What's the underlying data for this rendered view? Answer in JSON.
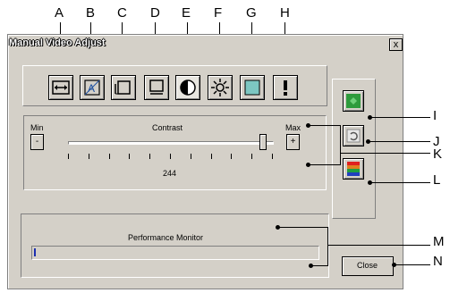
{
  "window": {
    "title": "Manual Video Adjust",
    "close_glyph": "x"
  },
  "toolbar": {
    "buttons": [
      {
        "id": "A",
        "icon": "width-adjust-icon"
      },
      {
        "id": "B",
        "icon": "focus-icon"
      },
      {
        "id": "C",
        "icon": "horizontal-position-icon"
      },
      {
        "id": "D",
        "icon": "vertical-position-icon"
      },
      {
        "id": "E",
        "icon": "contrast-icon"
      },
      {
        "id": "F",
        "icon": "brightness-icon"
      },
      {
        "id": "G",
        "icon": "noise-threshold-icon"
      },
      {
        "id": "H",
        "icon": "priority-threshold-icon"
      }
    ]
  },
  "adjust": {
    "min_label": "Min",
    "max_label": "Max",
    "name": "Contrast",
    "minus": "-",
    "plus": "+",
    "value": "244",
    "slider_fraction": 0.957
  },
  "side": {
    "buttons": [
      {
        "id": "I",
        "icon": "auto-adjust-icon"
      },
      {
        "id": "J",
        "icon": "refresh-icon"
      },
      {
        "id": "L",
        "icon": "color-bars-icon"
      }
    ]
  },
  "performance": {
    "label": "Performance Monitor"
  },
  "close_button": {
    "label": "Close"
  },
  "callouts": [
    "A",
    "B",
    "C",
    "D",
    "E",
    "F",
    "G",
    "H",
    "I",
    "J",
    "K",
    "L",
    "M",
    "N"
  ],
  "colors": {
    "dialog_bg": "#d4d0c8",
    "green_button": "#2e9b3c",
    "teal_icon": "#7cc7c2"
  }
}
